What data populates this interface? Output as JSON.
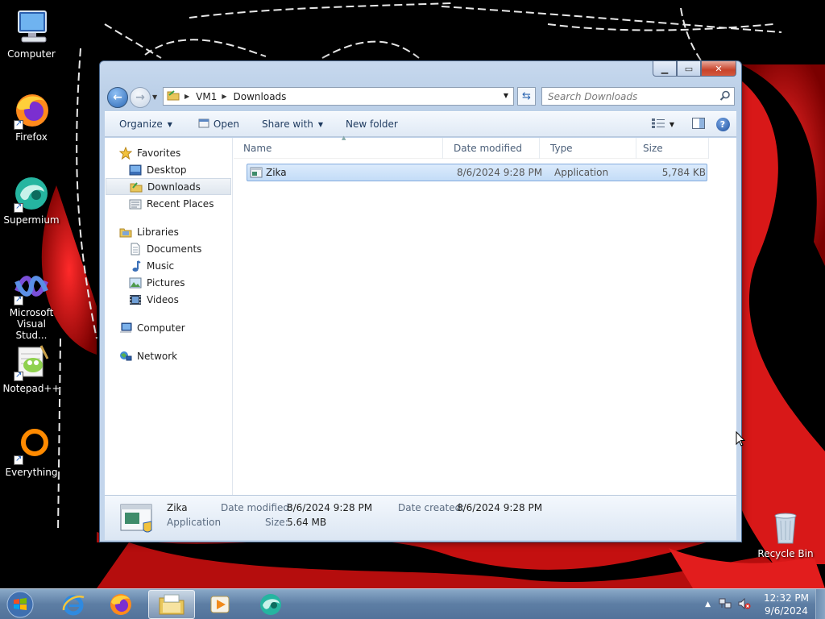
{
  "desktop": {
    "icons": [
      {
        "label": "Computer",
        "icon": "computer-icon"
      },
      {
        "label": "Firefox",
        "icon": "firefox-icon"
      },
      {
        "label": "Supermium",
        "icon": "supermium-icon"
      },
      {
        "label": "Microsoft Visual Stud...",
        "icon": "visual-studio-icon"
      },
      {
        "label": "Notepad++",
        "icon": "notepad-plus-plus-icon"
      },
      {
        "label": "Everything",
        "icon": "everything-icon"
      },
      {
        "label": "Recycle Bin",
        "icon": "recycle-bin-icon"
      }
    ]
  },
  "window": {
    "address": {
      "crumbs": [
        "VM1",
        "Downloads"
      ]
    },
    "search": {
      "placeholder": "Search Downloads"
    },
    "toolbar": {
      "organize": "Organize",
      "open": "Open",
      "share_with": "Share with",
      "new_folder": "New folder"
    },
    "nav": {
      "favorites": {
        "label": "Favorites",
        "items": [
          "Desktop",
          "Downloads",
          "Recent Places"
        ],
        "selected": "Downloads"
      },
      "libraries": {
        "label": "Libraries",
        "items": [
          "Documents",
          "Music",
          "Pictures",
          "Videos"
        ]
      },
      "computer": "Computer",
      "network": "Network"
    },
    "columns": [
      "Name",
      "Date modified",
      "Type",
      "Size"
    ],
    "files": [
      {
        "name": "Zika",
        "date_modified": "8/6/2024 9:28 PM",
        "type": "Application",
        "size": "5,784 KB"
      }
    ],
    "details": {
      "name": "Zika",
      "type": "Application",
      "date_modified_label": "Date modified:",
      "date_modified": "8/6/2024 9:28 PM",
      "size_label": "Size:",
      "size": "5.64 MB",
      "date_created_label": "Date created:",
      "date_created": "8/6/2024 9:28 PM"
    }
  },
  "taskbar": {
    "apps": [
      "internet-explorer-icon",
      "firefox-icon",
      "file-explorer-icon",
      "media-player-icon",
      "supermium-icon"
    ],
    "active_app": "file-explorer-icon",
    "clock": {
      "time": "12:32 PM",
      "date": "9/6/2024"
    }
  },
  "colors": {
    "accent": "#2e6ab6",
    "selection": "#c3dcf7",
    "wallpaper_red": "#d41414"
  }
}
